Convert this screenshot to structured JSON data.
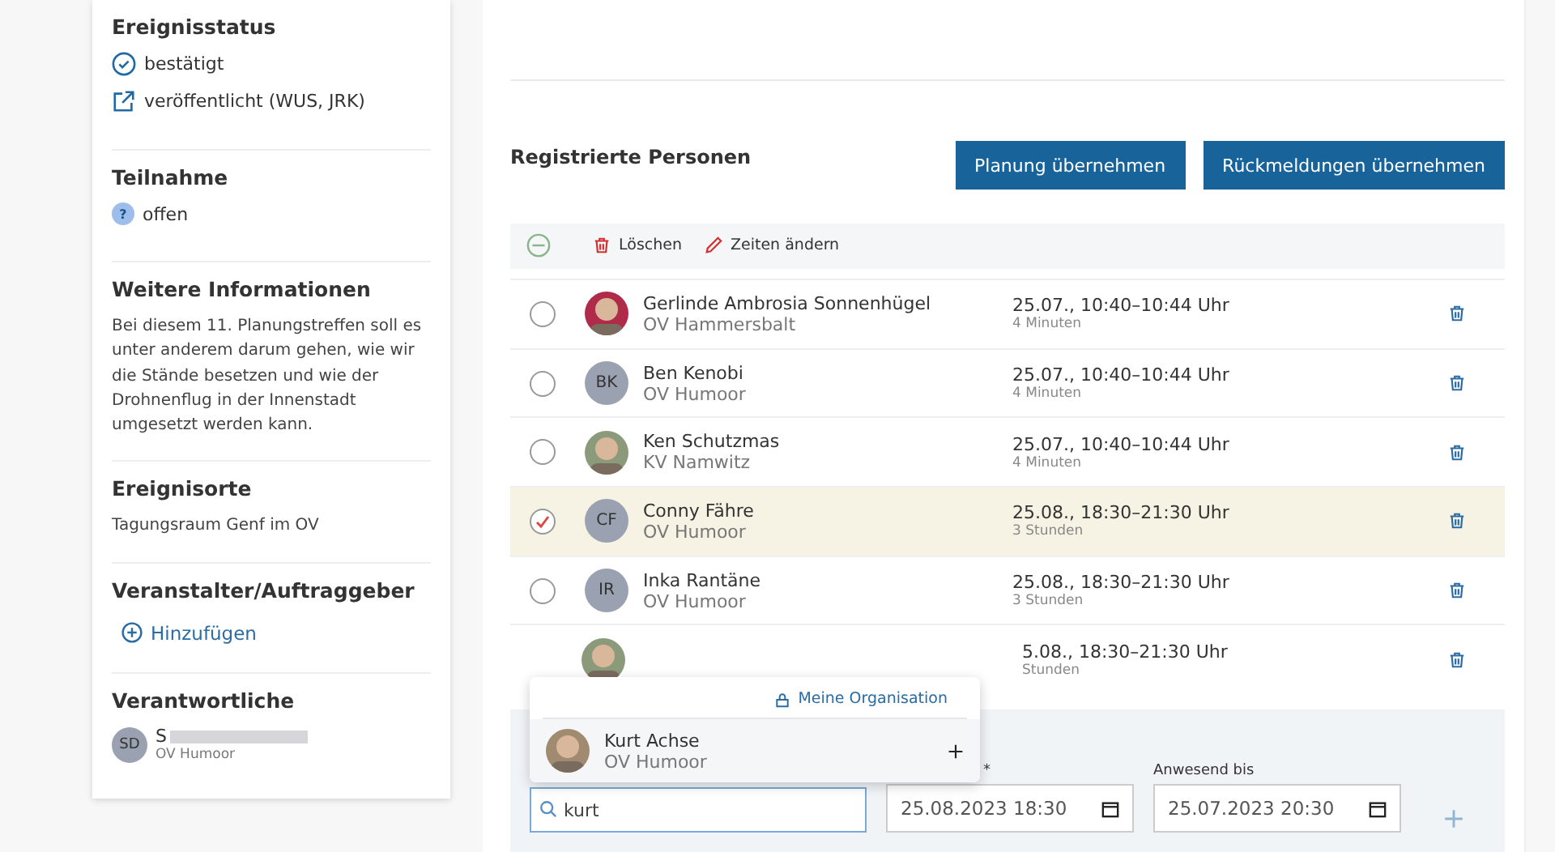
{
  "sidebar": {
    "sections": [
      {
        "kind": "status",
        "title": "Ereignisstatus",
        "items": [
          {
            "kind": "check",
            "text": "bestätigt"
          },
          {
            "kind": "external",
            "text": "veröffentlicht (WUS, JRK)"
          }
        ]
      },
      {
        "kind": "status",
        "title": "Teilnahme",
        "items": [
          {
            "kind": "question",
            "glyph": "?",
            "text": "offen"
          }
        ]
      },
      {
        "kind": "text",
        "title": "Weitere Informationen",
        "text": "Bei diesem 11. Planungstreffen soll es unter anderem darum gehen, wie wir die Stände besetzen und wie der Drohnenflug in der Innenstadt umgesetzt werden kann."
      },
      {
        "kind": "text",
        "title": "Ereignisorte",
        "text": "Tagungsraum Genf im OV"
      },
      {
        "kind": "add",
        "title": "Veranstalter/Auftraggeber",
        "link": "Hinzufügen"
      },
      {
        "kind": "person",
        "title": "Verantwortliche",
        "initials": "SD",
        "name": "S",
        "org": "OV Humoor"
      }
    ]
  },
  "main": {
    "title": "Registrierte Personen",
    "buttons": [
      "Planung übernehmen",
      "Rückmeldungen übernehmen"
    ],
    "toolbar": {
      "delete": "Löschen",
      "edit": "Zeiten ändern"
    },
    "rows": [
      {
        "name": "Gerlinde Ambrosia Sonnenhügel",
        "org": "OV Hammersbalt",
        "time": "25.07., 10:40–10:44 Uhr",
        "duration": "4 Minuten",
        "selected": false
      },
      {
        "kind": "initials",
        "initials": "BK",
        "name": "Ben Kenobi",
        "org": "OV Humoor",
        "time": "25.07., 10:40–10:44 Uhr",
        "duration": "4 Minuten",
        "selected": false
      },
      {
        "name": "Ken Schutzmas",
        "org": "KV Namwitz",
        "time": "25.07., 10:40–10:44 Uhr",
        "duration": "4 Minuten",
        "selected": false
      },
      {
        "kind": "initials",
        "initials": "CF",
        "name": "Conny Fähre",
        "org": "OV Humoor",
        "time": "25.08., 18:30–21:30 Uhr",
        "duration": "3 Stunden",
        "selected": true
      },
      {
        "kind": "initials",
        "initials": "IR",
        "name": "Inka Rantäne",
        "org": "OV Humoor",
        "time": "25.08., 18:30–21:30 Uhr",
        "duration": "3 Stunden",
        "selected": false
      },
      {
        "kind": "covered",
        "time": "5.08., 18:30–21:30 Uhr",
        "duration": "Stunden"
      }
    ],
    "form": {
      "search_value": "kurt",
      "from_label": "*",
      "from_value": "25.08.2023 18:30",
      "to_label": "Anwesend bis",
      "to_value": "25.07.2023 20:30"
    },
    "dropdown": {
      "header": "Meine Organisation",
      "results": [
        {
          "name": "Kurt Achse",
          "org": "OV Humoor"
        }
      ]
    }
  }
}
